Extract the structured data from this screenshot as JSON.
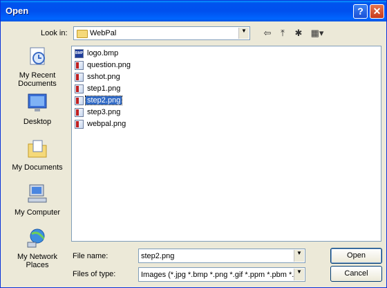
{
  "window": {
    "title": "Open",
    "help_label": "?",
    "close_label": "✕"
  },
  "lookin": {
    "label": "Look in:",
    "value": "WebPal",
    "arrow": "▼"
  },
  "toolbar": {
    "back_glyph": "⇦",
    "up_glyph": "⤒",
    "newfolder_glyph": "✱",
    "views_glyph": "▦▾"
  },
  "places": [
    {
      "label": "My Recent Documents",
      "icon": "recent-documents-icon"
    },
    {
      "label": "Desktop",
      "icon": "desktop-icon"
    },
    {
      "label": "My Documents",
      "icon": "my-documents-icon"
    },
    {
      "label": "My Computer",
      "icon": "my-computer-icon"
    },
    {
      "label": "My Network Places",
      "icon": "network-places-icon"
    }
  ],
  "files": [
    {
      "name": "logo.bmp",
      "icon": "bmp-file-icon",
      "ext": "BMP"
    },
    {
      "name": "question.png",
      "icon": "png-file-icon"
    },
    {
      "name": "sshot.png",
      "icon": "png-file-icon"
    },
    {
      "name": "step1.png",
      "icon": "png-file-icon"
    },
    {
      "name": "step2.png",
      "icon": "png-file-icon",
      "selected": true
    },
    {
      "name": "step3.png",
      "icon": "png-file-icon"
    },
    {
      "name": "webpal.png",
      "icon": "png-file-icon"
    }
  ],
  "filename": {
    "label": "File name:",
    "value": "step2.png"
  },
  "filetype": {
    "label": "Files of type:",
    "value": "Images (*.jpg *.bmp *.png *.gif *.ppm *.pbm *.pg"
  },
  "buttons": {
    "open": "Open",
    "cancel": "Cancel"
  },
  "colors": {
    "titlebar": "#0053ee",
    "selection": "#316ac5",
    "dialog_bg": "#ece9d8"
  }
}
